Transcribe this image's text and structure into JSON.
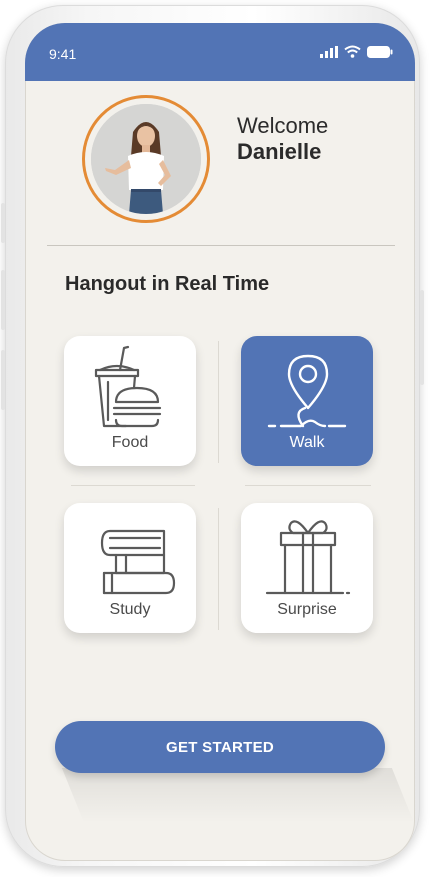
{
  "status_bar": {
    "time": "9:41",
    "icons": [
      "signal-icon",
      "wifi-icon",
      "battery-icon"
    ]
  },
  "profile": {
    "greeting": "Welcome",
    "name": "Danielle",
    "avatar_icon": "profile-photo"
  },
  "section_title": "Hangout in Real Time",
  "options": [
    {
      "label": "Food",
      "icon": "food-drink-burger-icon",
      "selected": false
    },
    {
      "label": "Walk",
      "icon": "location-pin-path-icon",
      "selected": true
    },
    {
      "label": "Study",
      "icon": "books-stack-icon",
      "selected": false
    },
    {
      "label": "Surprise",
      "icon": "gift-box-icon",
      "selected": false
    }
  ],
  "cta": {
    "label": "GET STARTED"
  },
  "colors": {
    "accent": "#5274b5",
    "avatar_ring": "#e48b35",
    "background": "#f3f1ec",
    "card": "#ffffff",
    "icon_stroke": "#5a5a5a"
  }
}
